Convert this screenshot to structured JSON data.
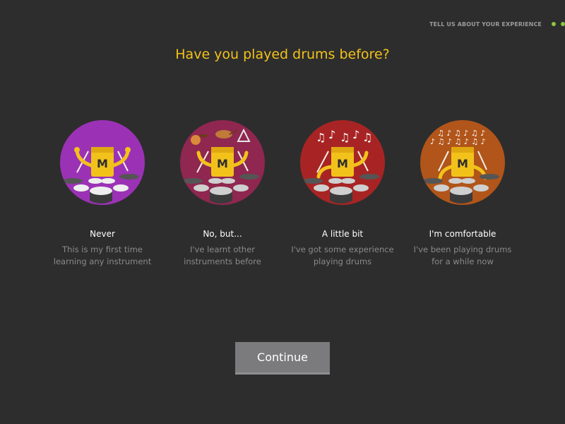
{
  "header": {
    "step_label": "TELL US ABOUT YOUR EXPERIENCE",
    "progress_dots": 2,
    "dot_color": "#8cc63f"
  },
  "question": "Have you played drums before?",
  "question_color": "#f2c21b",
  "options": [
    {
      "title": "Never",
      "description": [
        "This is my first time",
        "learning any instrument"
      ],
      "color": "#9b32b6",
      "illustration": "drummer-mascot-icon",
      "selected": false
    },
    {
      "title": "No, but...",
      "description": [
        "I've learnt other",
        "instruments before"
      ],
      "color": "#8f2750",
      "illustration": "drummer-mascot-with-instruments-icon",
      "selected": false
    },
    {
      "title": "A little bit",
      "description": [
        "I've got some experience",
        "playing drums"
      ],
      "color": "#a82424",
      "illustration": "drummer-mascot-with-notes-icon",
      "selected": false
    },
    {
      "title": "I'm comfortable",
      "description": [
        "I've been playing drums",
        "for a while now"
      ],
      "color": "#b1551a",
      "illustration": "drummer-mascot-with-many-notes-icon",
      "selected": false
    }
  ],
  "continue_label": "Continue",
  "mascot_letter": "M",
  "mascot_color": "#f2c21b"
}
